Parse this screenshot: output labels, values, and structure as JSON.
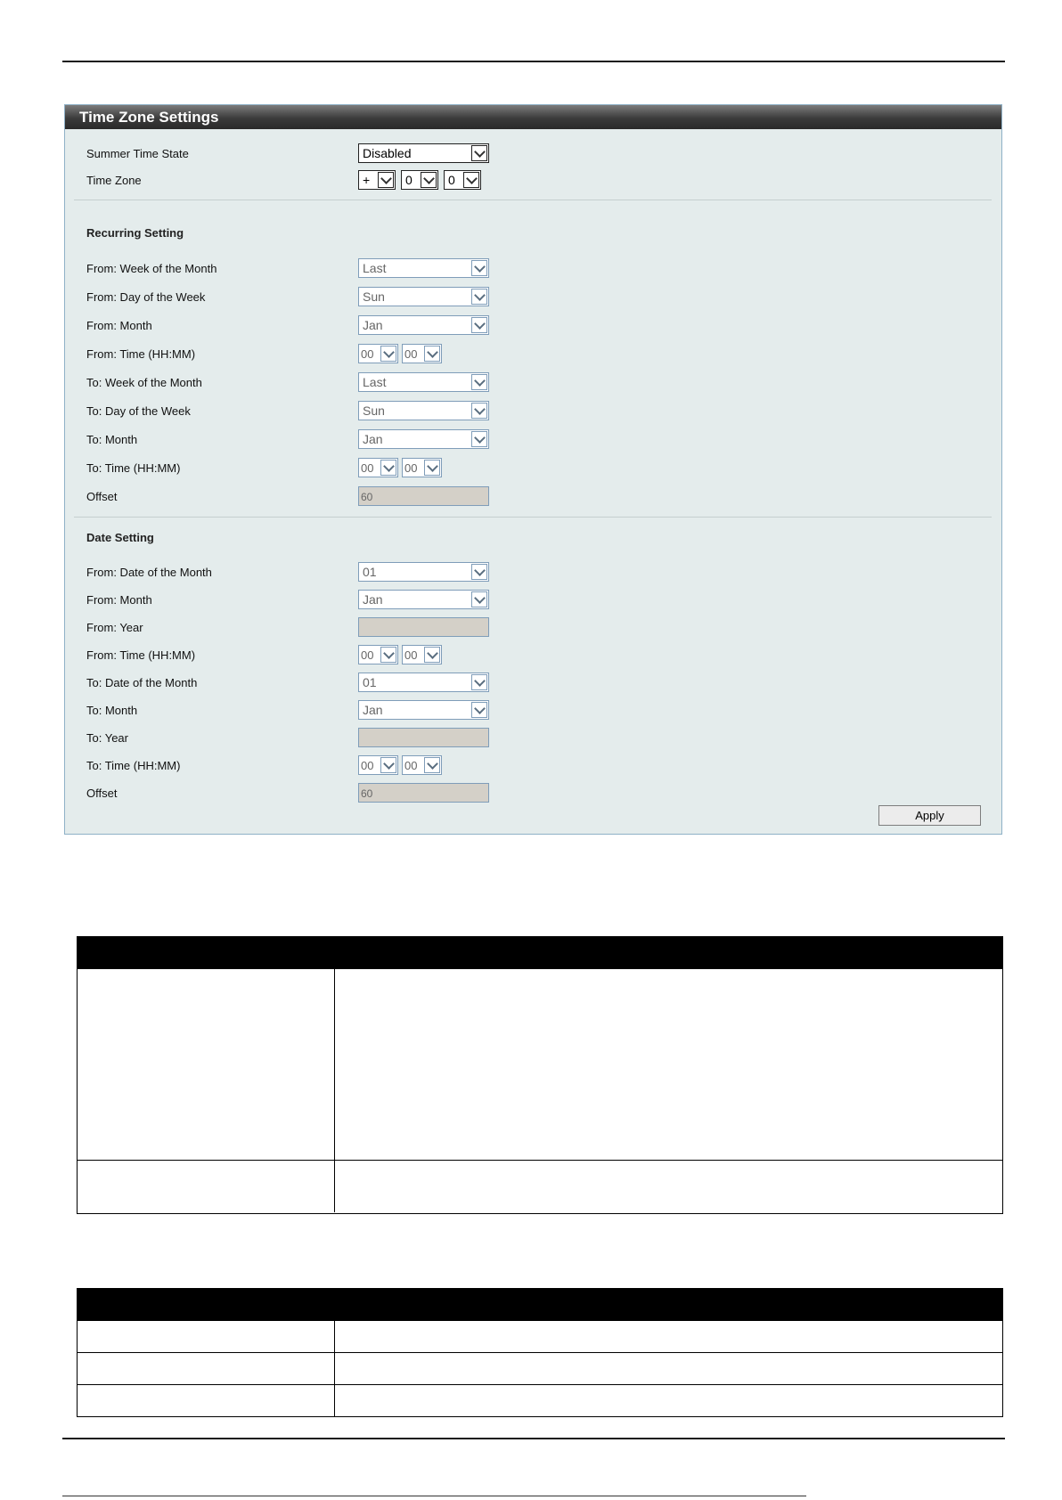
{
  "panel": {
    "title": "Time Zone Settings"
  },
  "general": {
    "summer_time_state": {
      "label": "Summer Time State",
      "value": "Disabled"
    },
    "time_zone": {
      "label": "Time Zone",
      "sign": "+",
      "hours": "0",
      "minutes": "0"
    }
  },
  "recurring": {
    "title": "Recurring Setting",
    "from_week": {
      "label": "From: Week of the Month",
      "value": "Last"
    },
    "from_day": {
      "label": "From: Day of the Week",
      "value": "Sun"
    },
    "from_month": {
      "label": "From: Month",
      "value": "Jan"
    },
    "from_time": {
      "label": "From: Time (HH:MM)",
      "hh": "00",
      "mm": "00"
    },
    "to_week": {
      "label": "To: Week of the Month",
      "value": "Last"
    },
    "to_day": {
      "label": "To: Day of the Week",
      "value": "Sun"
    },
    "to_month": {
      "label": "To: Month",
      "value": "Jan"
    },
    "to_time": {
      "label": "To: Time (HH:MM)",
      "hh": "00",
      "mm": "00"
    },
    "offset": {
      "label": "Offset",
      "value": "60"
    }
  },
  "date": {
    "title": "Date Setting",
    "from_date": {
      "label": "From: Date of the Month",
      "value": "01"
    },
    "from_month": {
      "label": "From: Month",
      "value": "Jan"
    },
    "from_year": {
      "label": "From: Year",
      "value": ""
    },
    "from_time": {
      "label": "From: Time (HH:MM)",
      "hh": "00",
      "mm": "00"
    },
    "to_date": {
      "label": "To: Date of the Month",
      "value": "01"
    },
    "to_month": {
      "label": "To: Month",
      "value": "Jan"
    },
    "to_year": {
      "label": "To: Year",
      "value": ""
    },
    "to_time": {
      "label": "To: Time (HH:MM)",
      "hh": "00",
      "mm": "00"
    },
    "offset": {
      "label": "Offset",
      "value": "60"
    }
  },
  "buttons": {
    "apply": "Apply"
  }
}
